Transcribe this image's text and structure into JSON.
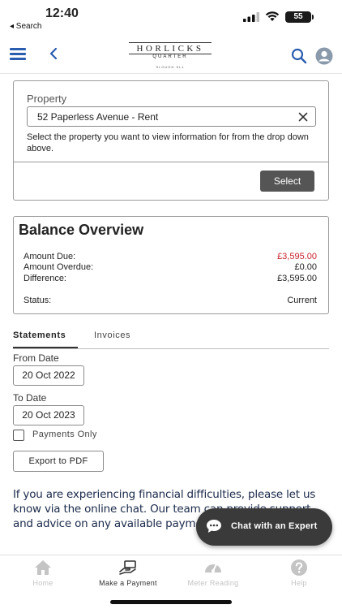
{
  "status_bar": {
    "time": "12:40",
    "back_label": "◂ Search",
    "battery": "55"
  },
  "header": {
    "logo_name": "HORLICKS",
    "logo_sub": "QUARTER",
    "logo_tiny": "SLOUGH SL1"
  },
  "property": {
    "label": "Property",
    "selected": "52 Paperless Avenue - Rent",
    "help": "Select the property you want to view information for from the drop down above.",
    "select_button": "Select"
  },
  "balance": {
    "title": "Balance Overview",
    "rows": [
      {
        "label": "Amount Due:",
        "value": "£3,595.00"
      },
      {
        "label": "Amount Overdue:",
        "value": "£0.00"
      },
      {
        "label": "Difference:",
        "value": "£3,595.00"
      }
    ],
    "status_label": "Status:",
    "status_value": "Current"
  },
  "tabs": {
    "statements": "Statements",
    "invoices": "Invoices"
  },
  "filters": {
    "from_label": "From Date",
    "from_value": "20 Oct 2022",
    "to_label": "To Date",
    "to_value": "20 Oct 2023",
    "payments_only": "Payments Only",
    "export_button": "Export to PDF"
  },
  "info_text": "If you are experiencing financial difficulties, please let us know via the online chat.  Our team can provide support and advice on any available payment options.",
  "chat": {
    "label": "Chat with an Expert"
  },
  "nav": {
    "home": "Home",
    "payment": "Make a Payment",
    "meter": "Meter Reading",
    "help": "Help"
  },
  "colors": {
    "accent": "#2a5db0",
    "amount_due": "#c8232c",
    "chat_bg": "#3a3a3a"
  }
}
